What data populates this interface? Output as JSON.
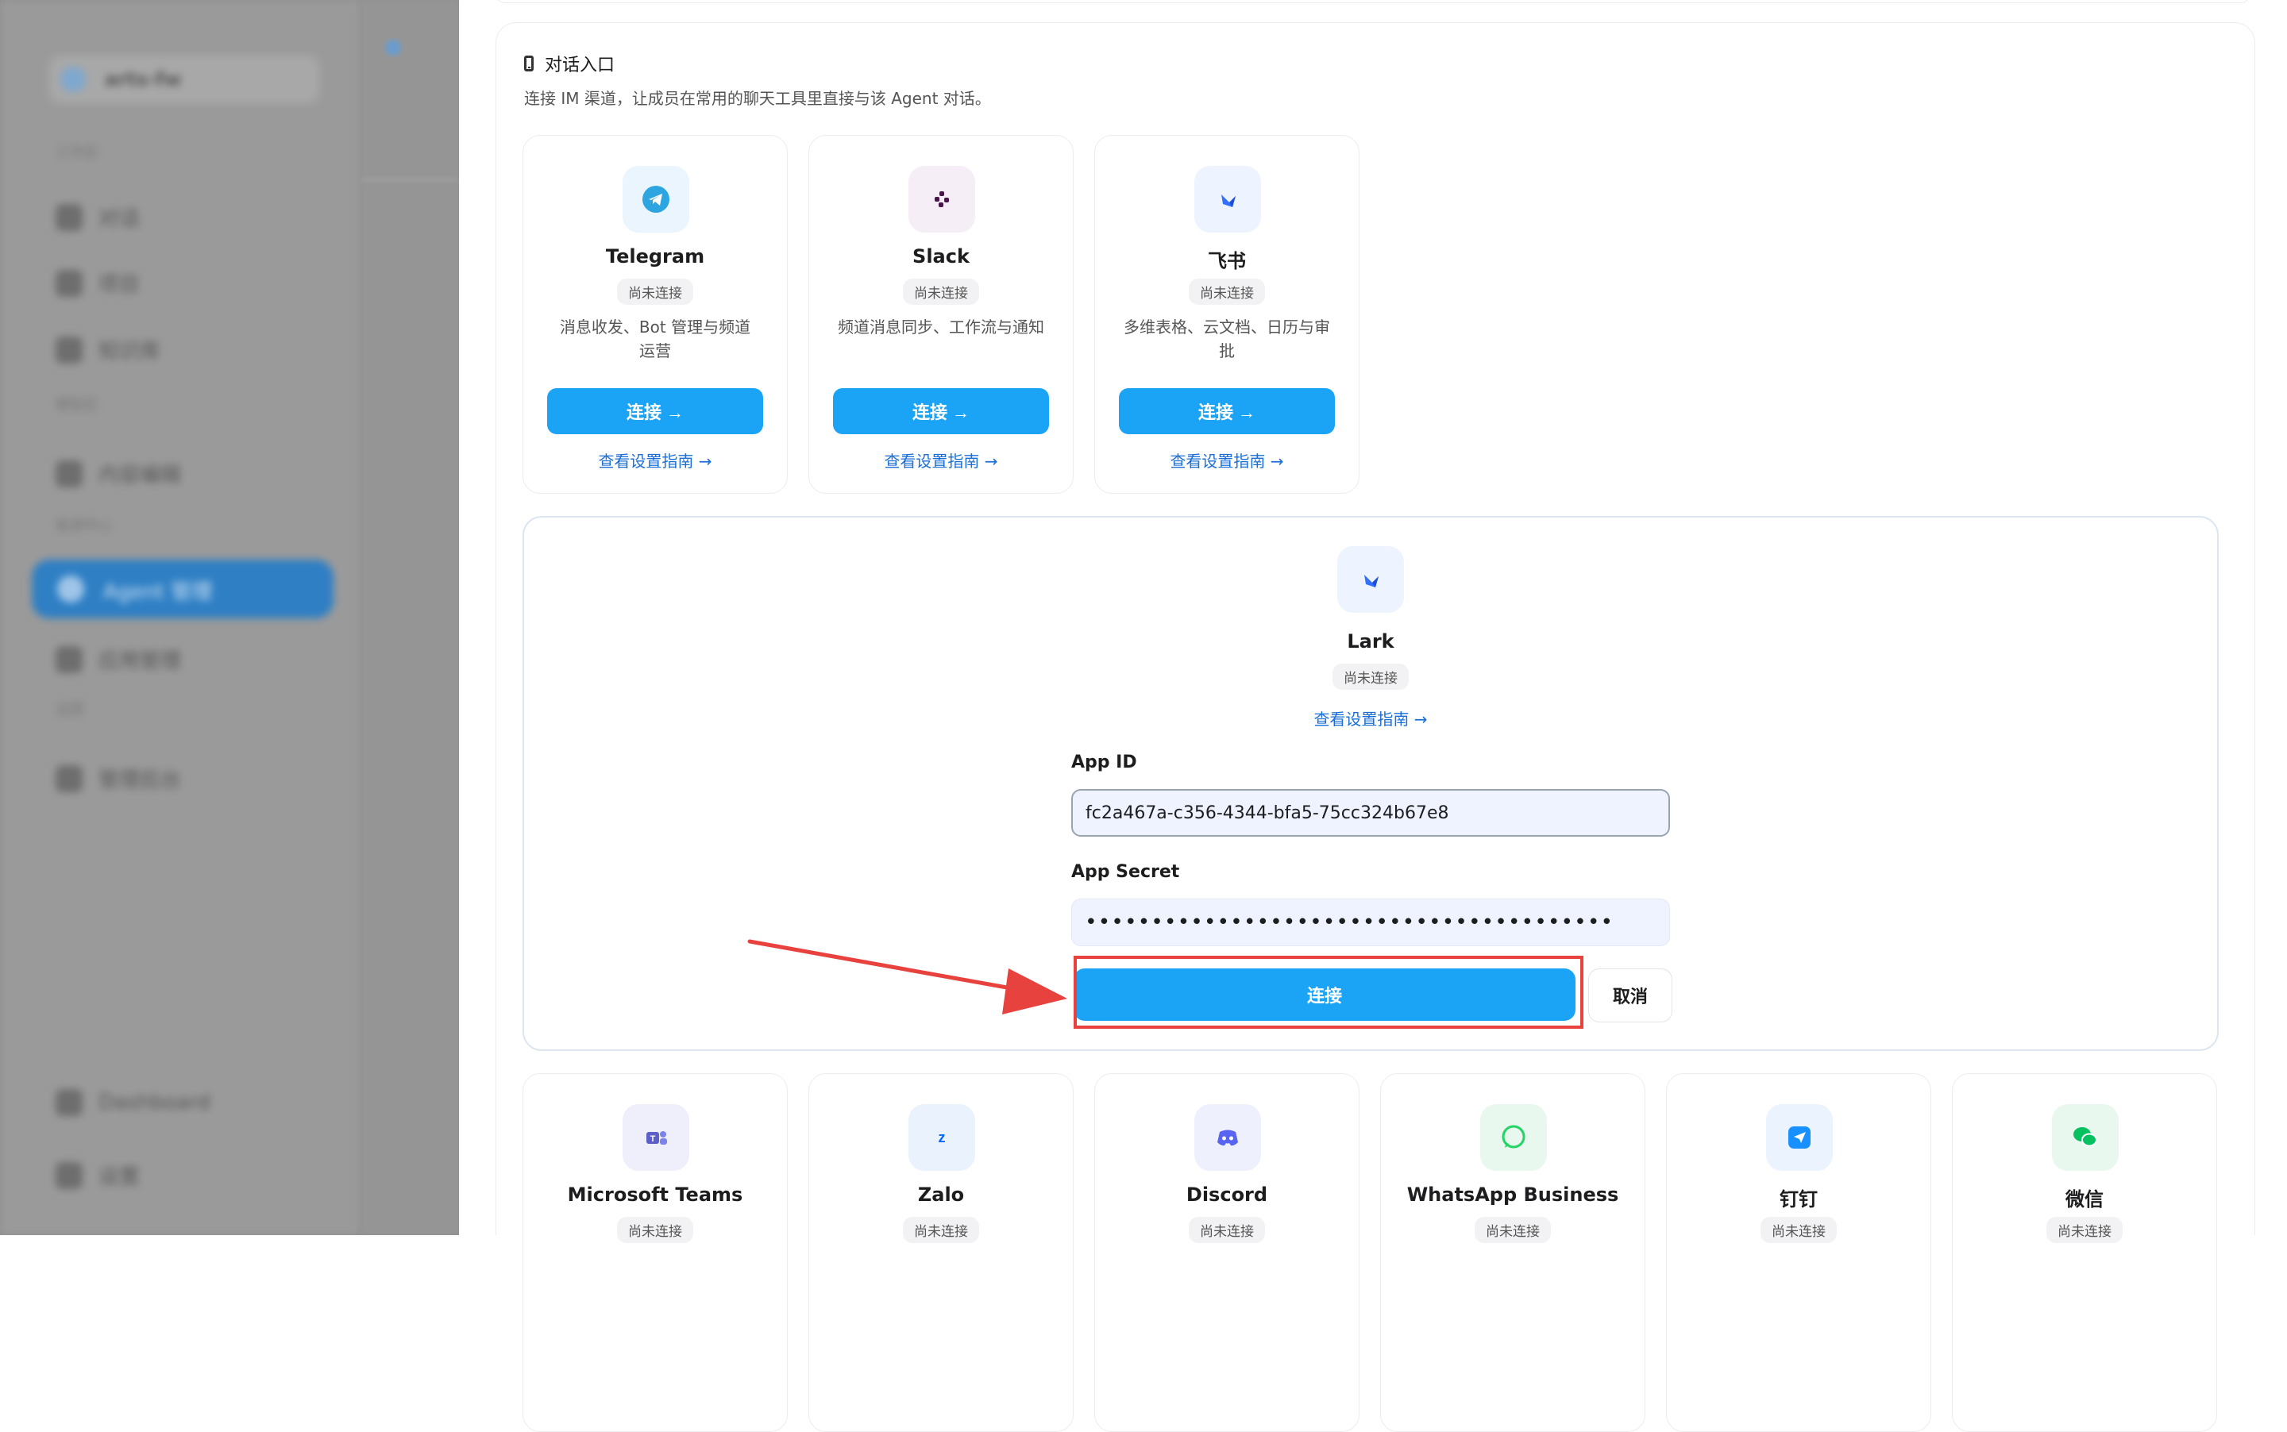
{
  "background": {
    "workspace": "arts-fw",
    "groups": [
      "工作区",
      "模型区",
      "能源中心",
      "运营"
    ],
    "items": [
      "对话",
      "项目",
      "知识库",
      "内容编辑",
      "应用管理",
      "管理后台",
      "Dashboard",
      "设置"
    ],
    "active_item": "Agent 管理"
  },
  "section": {
    "title": "对话入口",
    "subtitle": "连接 IM 渠道，让成员在常用的聊天工具里直接与该 Agent 对话。"
  },
  "cards_top": [
    {
      "name": "Telegram",
      "status": "尚未连接",
      "desc": "消息收发、Bot 管理与频道运营",
      "button": "连接 →",
      "guide": "查看设置指南 →",
      "icon": "telegram-icon"
    },
    {
      "name": "Slack",
      "status": "尚未连接",
      "desc": "频道消息同步、工作流与通知",
      "button": "连接 →",
      "guide": "查看设置指南 →",
      "icon": "slack-icon"
    },
    {
      "name": "飞书",
      "status": "尚未连接",
      "desc": "多维表格、云文档、日历与审批",
      "button": "连接 →",
      "guide": "查看设置指南 →",
      "icon": "feishu-icon"
    }
  ],
  "lark": {
    "name": "Lark",
    "status": "尚未连接",
    "guide": "查看设置指南 →",
    "app_id_label": "App ID",
    "app_id_value": "fc2a467a-c356-4344-bfa5-75cc324b67e8",
    "app_secret_label": "App Secret",
    "app_secret_value": "••••••••••••••••••••••••••••••••••••••••",
    "connect": "连接",
    "cancel": "取消",
    "icon": "lark-icon"
  },
  "cards_bottom": [
    {
      "name": "Microsoft Teams",
      "status": "尚未连接",
      "icon": "teams-icon"
    },
    {
      "name": "Zalo",
      "status": "尚未连接",
      "icon": "zalo-icon"
    },
    {
      "name": "Discord",
      "status": "尚未连接",
      "icon": "discord-icon"
    },
    {
      "name": "WhatsApp Business",
      "status": "尚未连接",
      "icon": "whatsapp-icon"
    },
    {
      "name": "钉钉",
      "status": "尚未连接",
      "icon": "dingtalk-icon"
    },
    {
      "name": "微信",
      "status": "尚未连接",
      "icon": "wechat-icon"
    }
  ],
  "colors": {
    "primary": "#1ba4f5",
    "link": "#1a6fd6",
    "highlight": "#e8423f"
  }
}
